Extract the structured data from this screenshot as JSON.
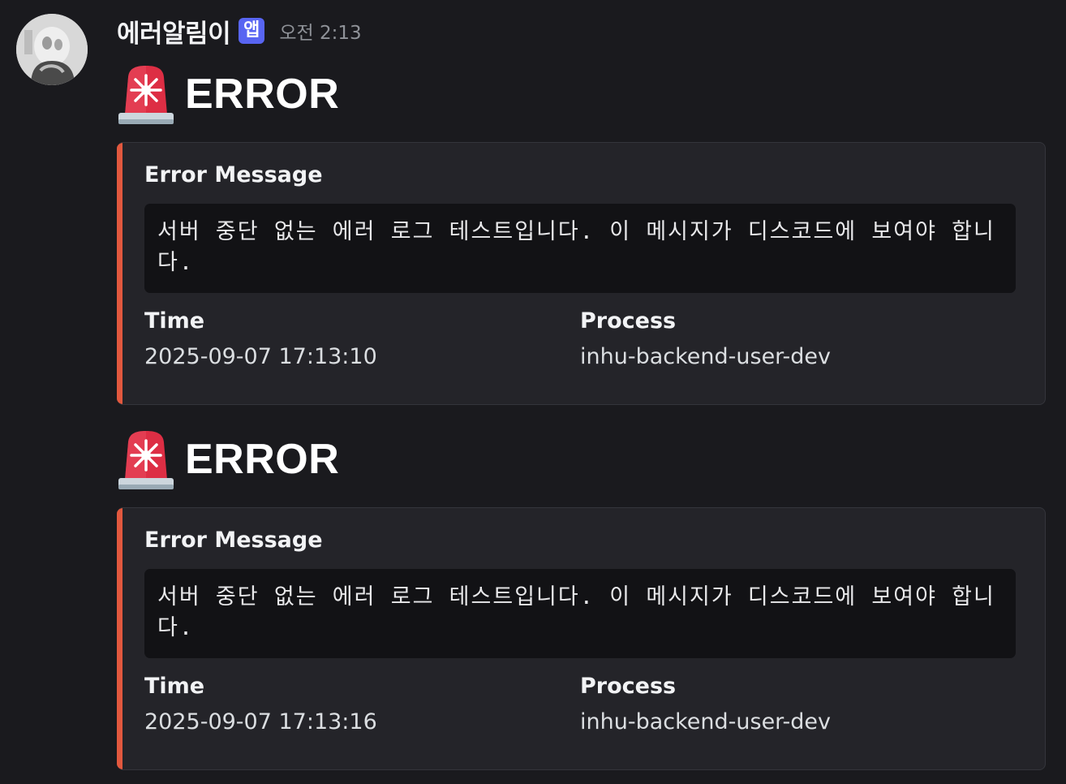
{
  "author": {
    "username": "에러알림이",
    "badge": "앱",
    "timestamp": "오전 2:13"
  },
  "messages": [
    {
      "title": "ERROR",
      "emoji": "rotating-light-icon",
      "embed": {
        "accent_color": "#e2583e",
        "message_label": "Error Message",
        "message_text": "서버 중단 없는 에러 로그 테스트입니다. 이 메시지가 디스코드에 보여야 합니다.",
        "time_label": "Time",
        "time_value": "2025-09-07 17:13:10",
        "process_label": "Process",
        "process_value": "inhu-backend-user-dev"
      }
    },
    {
      "title": "ERROR",
      "emoji": "rotating-light-icon",
      "embed": {
        "accent_color": "#e2583e",
        "message_label": "Error Message",
        "message_text": "서버 중단 없는 에러 로그 테스트입니다. 이 메시지가 디스코드에 보여야 합니다.",
        "time_label": "Time",
        "time_value": "2025-09-07 17:13:16",
        "process_label": "Process",
        "process_value": "inhu-backend-user-dev"
      }
    }
  ],
  "colors": {
    "background": "#1a1a1e",
    "embed_background": "#242429",
    "code_background": "#121215",
    "badge": "#5865f2"
  }
}
